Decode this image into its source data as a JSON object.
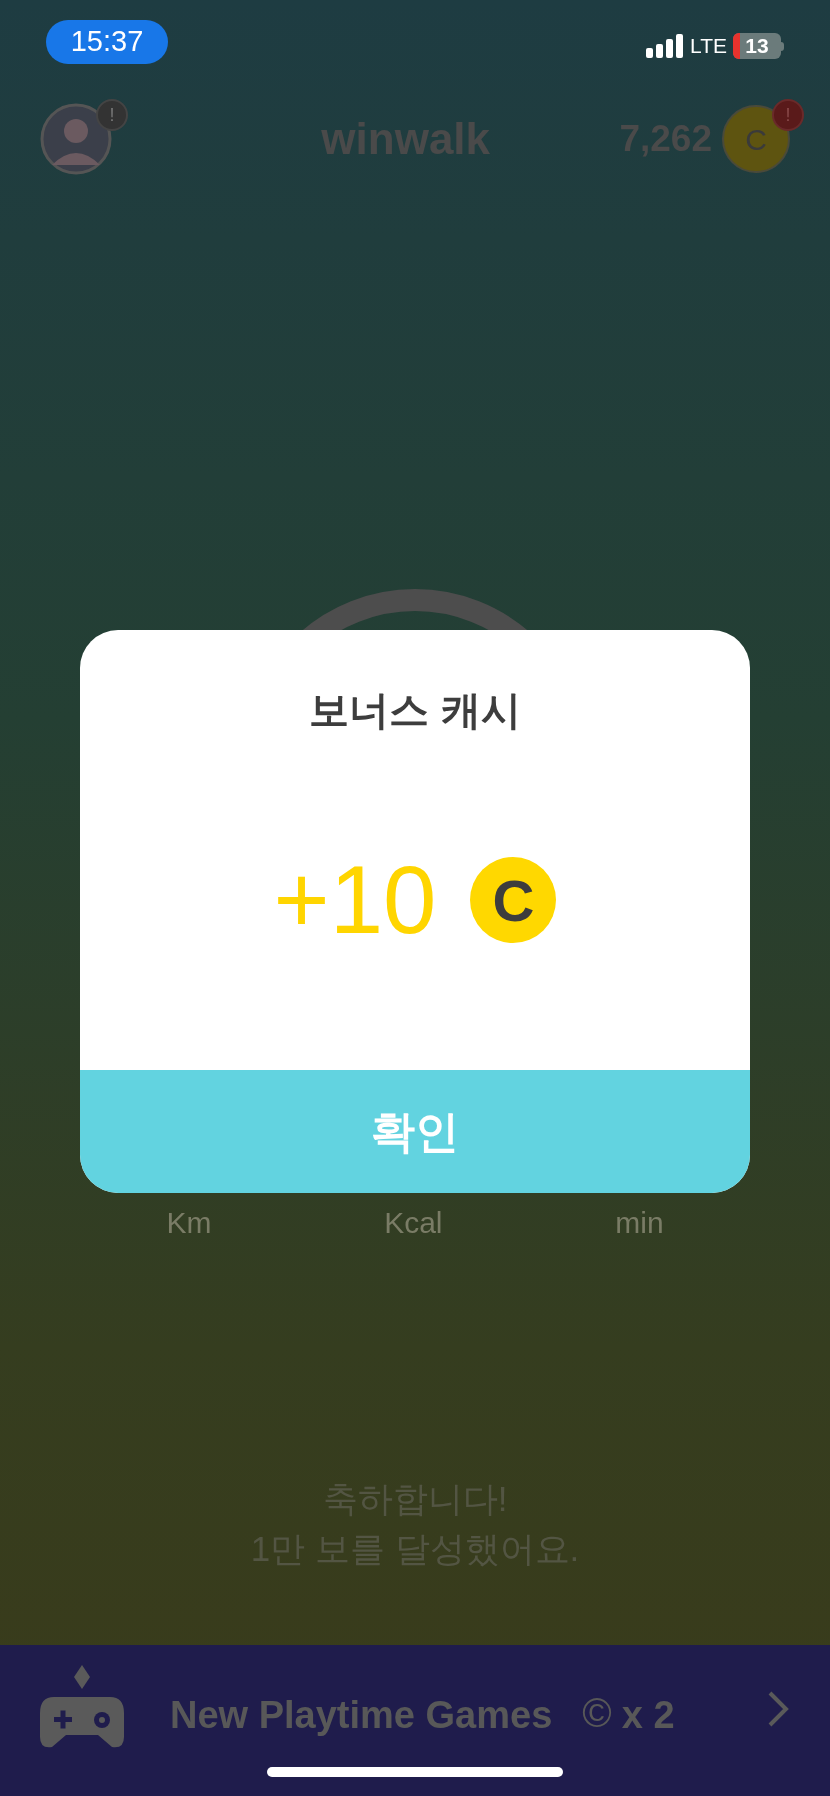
{
  "status_bar": {
    "time": "15:37",
    "network": "LTE",
    "battery": "13"
  },
  "header": {
    "avatar_alert": "!",
    "title": "winwalk",
    "balance": "7,262",
    "coin": "C",
    "coin_alert": "!"
  },
  "stats": [
    {
      "unit": "Km"
    },
    {
      "unit": "Kcal"
    },
    {
      "unit": "min"
    }
  ],
  "dialog": {
    "title": "보너스 캐시",
    "amount": "+10",
    "coin": "C",
    "button": "확인"
  },
  "message": [
    "축하합니다!",
    "1만 보를 달성했어요."
  ],
  "banner": {
    "title": "New Playtime Games",
    "coin_symbol": "©",
    "multiplier": "x 2"
  }
}
